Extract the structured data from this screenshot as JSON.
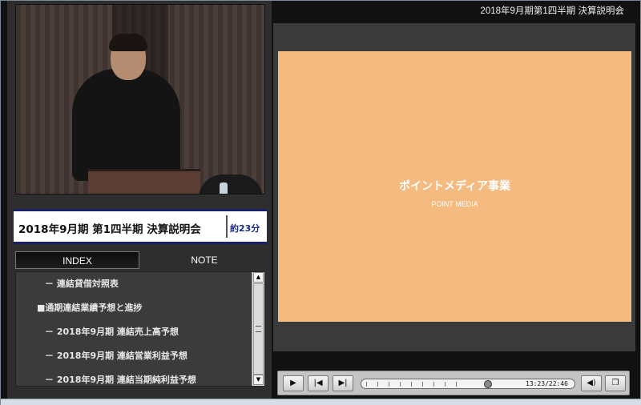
{
  "header": {
    "title": "2018年9月期第1四半期 決算説明会"
  },
  "session": {
    "title": "2018年9月期 第1四半期 決算説明会",
    "duration": "約23分"
  },
  "tabs": [
    {
      "label": "INDEX",
      "active": true
    },
    {
      "label": "NOTE",
      "active": false
    }
  ],
  "index_items": [
    {
      "label": "－ 連結貸借対照表",
      "level": "sub"
    },
    {
      "label": "■通期連結業績予想と進捗",
      "level": "top"
    },
    {
      "label": "－ 2018年9月期 連結売上高予想",
      "level": "sub"
    },
    {
      "label": "－ 2018年9月期 連結営業利益予想",
      "level": "sub"
    },
    {
      "label": "－ 2018年9月期 連結当期純利益予想",
      "level": "sub"
    }
  ],
  "slide": {
    "title": "ポイントメディア事業",
    "subtitle": "POINT MEDIA",
    "background": "#f4ba80"
  },
  "player": {
    "play_icon": "play-icon",
    "prev_icon": "skip-previous-icon",
    "next_icon": "skip-next-icon",
    "timecode": "13:23/22:46",
    "progress_fraction": 0.588,
    "volume_icon": "speaker-icon",
    "popout_icon": "popout-window-icon"
  },
  "colors": {
    "accent_navy": "#1a1f6b",
    "panel_dark": "#2e2e2e",
    "slide_orange": "#f4ba80"
  }
}
